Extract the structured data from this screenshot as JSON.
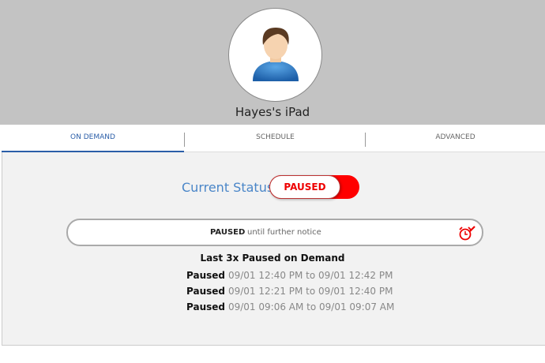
{
  "header": {
    "device_name": "Hayes's iPad"
  },
  "tabs": [
    {
      "label": "ON DEMAND",
      "active": true
    },
    {
      "label": "SCHEDULE",
      "active": false
    },
    {
      "label": "ADVANCED",
      "active": false
    }
  ],
  "status": {
    "label": "Current Status:",
    "toggle_label": "PAUSED"
  },
  "notice": {
    "bold": "PAUSED",
    "text": "until further notice",
    "icon": "alarm-clock-edit-icon"
  },
  "history": {
    "title": "Last 3x Paused on Demand",
    "rows": [
      {
        "label": "Paused",
        "range": "09/01 12:40 PM to 09/01 12:42 PM"
      },
      {
        "label": "Paused",
        "range": "09/01 12:21 PM to 09/01 12:40 PM"
      },
      {
        "label": "Paused",
        "range": "09/01 09:06 AM to 09/01 09:07 AM"
      }
    ]
  },
  "colors": {
    "accent": "#2b5ea8",
    "paused": "#ff0000",
    "status_label": "#4a86c8"
  }
}
